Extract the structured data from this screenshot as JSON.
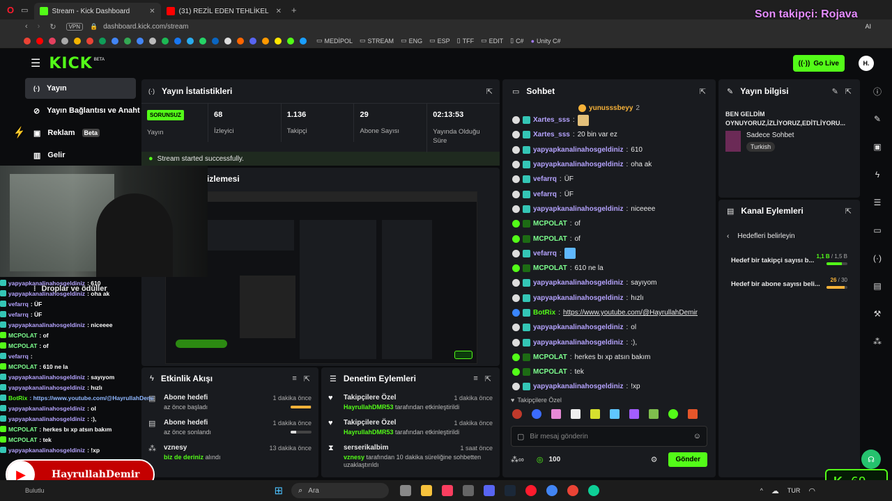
{
  "browser": {
    "tabs": [
      {
        "label": "Stream - Kick Dashboard",
        "active": true
      },
      {
        "label": "(31) REZİL EDEN TEHLİKEL",
        "active": false
      }
    ],
    "url": "dashboard.kick.com/stream",
    "vpn": "VPN",
    "bookmarks": [
      "MEDİPOL",
      "STREAM",
      "ENG",
      "ESP",
      "TFF",
      "EDIT",
      "C#",
      "Unity C#"
    ],
    "ai_label": "AI"
  },
  "overlay": {
    "last_follower": "Son takipçi: Rojava",
    "youtube_name": "HayrullahDemir",
    "viewer_count": "69"
  },
  "header": {
    "logo": "KICK",
    "logo_sub": "BETA",
    "go_live": "Go Live",
    "avatar": "H."
  },
  "sidebar": {
    "items": [
      {
        "label": "Yayın"
      },
      {
        "label": "Yayın Bağlantısı ve Anahtar"
      },
      {
        "label": "Reklam",
        "badge": "Beta"
      },
      {
        "label": "Gelir"
      },
      {
        "label": "Droplar ve ödüller"
      }
    ]
  },
  "stats": {
    "title": "Yayın İstatistikleri",
    "status": "SORUNSUZ",
    "status_label": "Yayın",
    "items": [
      {
        "value": "68",
        "label": "İzleyici"
      },
      {
        "value": "1.136",
        "label": "Takipçi"
      },
      {
        "value": "29",
        "label": "Abone Sayısı"
      },
      {
        "value": "02:13:53",
        "label": "Yayında Olduğu Süre"
      }
    ],
    "success": "Stream started successfully."
  },
  "preview": {
    "title": "Yayın Önizlemesi",
    "title_visible": "izlemesi"
  },
  "activity": {
    "title": "Etkinlik Akışı",
    "items": [
      {
        "title": "Abone hedefi",
        "sub": "az önce başladı",
        "time": "1 dakika önce",
        "progress": 0.95
      },
      {
        "title": "Abone hedefi",
        "sub": "az önce sonlandı",
        "time": "1 dakika önce",
        "progress": 0.25
      },
      {
        "title": "vznesy",
        "sub_user": "biz de deriniz",
        "sub": "alındı",
        "time": "13 dakika önce"
      }
    ]
  },
  "moderation": {
    "title": "Denetim Eylemleri",
    "items": [
      {
        "title": "Takipçilere Özel",
        "user": "HayrullahDMR53",
        "sub": "tarafından etkinleştirildi",
        "time": "1 dakika önce"
      },
      {
        "title": "Takipçilere Özel",
        "user": "HayrullahDMR53",
        "sub": "tarafından etkinleştirildi",
        "time": "1 dakika önce"
      },
      {
        "title": "serserikalbim",
        "user": "vznesy",
        "sub": "tarafından 10 dakika süreliğine sohbetten uzaklaştırıldı",
        "time": "1 saat önce"
      }
    ]
  },
  "chat": {
    "title": "Sohbet",
    "pinned_user": "yunusssbeyy",
    "pinned_count": "2",
    "messages": [
      {
        "user": "Xartes_sss",
        "text": "",
        "emote": true,
        "color": "p"
      },
      {
        "user": "Xartes_sss",
        "text": "20 bin var ez",
        "color": "p"
      },
      {
        "user": "yapyapkanalinahosgeldiniz",
        "text": "610",
        "color": "p"
      },
      {
        "user": "yapyapkanalinahosgeldiniz",
        "text": "oha ak",
        "color": "p"
      },
      {
        "user": "vefarrq",
        "text": "ÜF",
        "color": "p"
      },
      {
        "user": "vefarrq",
        "text": "ÜF",
        "color": "p"
      },
      {
        "user": "yapyapkanalinahosgeldiniz",
        "text": "niceeee",
        "color": "p"
      },
      {
        "user": "MCPOLAT",
        "text": "of",
        "color": "g"
      },
      {
        "user": "MCPOLAT",
        "text": "of",
        "color": "g"
      },
      {
        "user": "vefarrq",
        "text": "",
        "emote": true,
        "color": "p"
      },
      {
        "user": "MCPOLAT",
        "text": "610 ne la",
        "color": "g"
      },
      {
        "user": "yapyapkanalinahosgeldiniz",
        "text": "sayıyom",
        "color": "p"
      },
      {
        "user": "yapyapkanalinahosgeldiniz",
        "text": "hızlı",
        "color": "p"
      },
      {
        "user": "BotRix",
        "text": "https://www.youtube.com/@HayrullahDemir",
        "color": "c",
        "link": true
      },
      {
        "user": "yapyapkanalinahosgeldiniz",
        "text": "ol",
        "color": "p"
      },
      {
        "user": "yapyapkanalinahosgeldiniz",
        "text": ":),",
        "color": "p"
      },
      {
        "user": "MCPOLAT",
        "text": "herkes bı xp atsın bakım",
        "color": "g"
      },
      {
        "user": "MCPOLAT",
        "text": "tek",
        "color": "g"
      },
      {
        "user": "yapyapkanalinahosgeldiniz",
        "text": "!xp",
        "color": "p"
      }
    ],
    "mode_label": "Takipçilere Özel",
    "input_placeholder": "Bir mesaj gönderin",
    "points": "100",
    "send": "Gönder"
  },
  "stream_info": {
    "title": "Yayın bilgisi",
    "stream_title": "BEN GELDİM OYNUYORUZ,İZLİYORUZ,EDİTLİYORU...",
    "category": "Sadece Sohbet",
    "language": "Turkish"
  },
  "channel_actions": {
    "title": "Kanal Eylemleri",
    "back": "Hedefleri belirleyin",
    "goals": [
      {
        "label": "Hedef bir takipçi sayısı b...",
        "current": "1,1 B",
        "target": "/ 1,5 B",
        "progress": 0.73
      },
      {
        "label": "Hedef bir abone sayısı beli...",
        "current": "26",
        "target": "/ 30",
        "progress": 0.87
      }
    ]
  },
  "overlay_chat": [
    {
      "user": "yapyapkanalinahosgeldiniz",
      "text": ": 610"
    },
    {
      "user": "yapyapkanalinahosgeldiniz",
      "text": ": oha ak"
    },
    {
      "user": "vefarrq",
      "text": ": ÜF"
    },
    {
      "user": "vefarrq",
      "text": ": ÜF"
    },
    {
      "user": "yapyapkanalinahosgeldiniz",
      "text": ": niceeee"
    },
    {
      "user": "MCPOLAT",
      "text": ": of"
    },
    {
      "user": "MCPOLAT",
      "text": ": of"
    },
    {
      "user": "vefarrq",
      "text": ":"
    },
    {
      "user": "MCPOLAT",
      "text": ": 610 ne la"
    },
    {
      "user": "yapyapkanalinahosgeldiniz",
      "text": ": sayıyom"
    },
    {
      "user": "yapyapkanalinahosgeldiniz",
      "text": ": hızlı"
    },
    {
      "user": "BotRix",
      "text": ": https://www.youtube.com/@HayrullahDemir"
    },
    {
      "user": "yapyapkanalinahosgeldiniz",
      "text": ": ol"
    },
    {
      "user": "yapyapkanalinahosgeldiniz",
      "text": ": :),"
    },
    {
      "user": "MCPOLAT",
      "text": ": herkes bı xp atsın bakım"
    },
    {
      "user": "MCPOLAT",
      "text": ": tek"
    },
    {
      "user": "yapyapkanalinahosgeldiniz",
      "text": ": !xp"
    }
  ],
  "taskbar": {
    "search": "Ara",
    "lang": "TUR",
    "weather": "Bulutlu"
  }
}
